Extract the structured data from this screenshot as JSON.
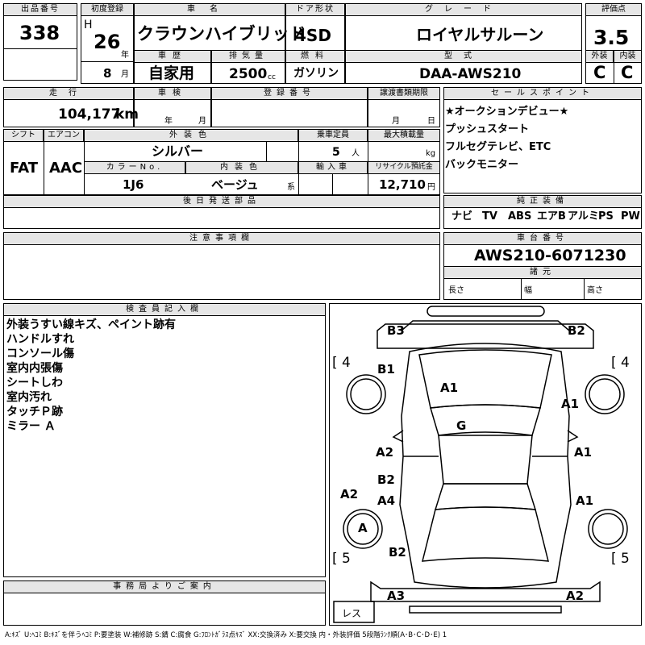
{
  "header": {
    "lot_label": "出品番号",
    "lot_number": "338",
    "first_reg_label": "初度登録",
    "era": "H",
    "year": "26",
    "year_unit": "年",
    "month": "8",
    "month_unit": "月",
    "car_name_label": "車名",
    "car_name": "クラウンハイブリッド",
    "history_label": "車歴",
    "history": "自家用",
    "displacement_label": "排気量",
    "displacement": "2500",
    "displacement_unit": "cc",
    "door_label": "ドア形状",
    "door": "4SD",
    "fuel_label": "燃料",
    "fuel": "ガソリン",
    "grade_label": "グレード",
    "grade": "ロイヤルサルーン",
    "model_label": "型式",
    "model": "DAA-AWS210",
    "score_label": "評価点",
    "score": "3.5",
    "exterior_label": "外装",
    "exterior": "C",
    "interior_label": "内装",
    "interior": "C"
  },
  "row2": {
    "mileage_label": "走行",
    "mileage": "104,177",
    "mileage_unit": "km",
    "inspection_label": "車検",
    "year_unit": "年",
    "month_unit": "月",
    "reg_label": "登録番号",
    "transfer_label": "譲渡書類期限",
    "day_unit": "日"
  },
  "spec": {
    "shift_label": "シフト",
    "shift": "FAT",
    "ac_label": "エアコン",
    "ac": "AAC",
    "ext_color_label": "外装色",
    "ext_color": "シルバー",
    "capacity_label": "乗車定員",
    "capacity": "5",
    "capacity_unit": "人",
    "load_label": "最大積載量",
    "load_unit": "kg",
    "color_no_label": "カラーNo.",
    "color_no": "1J6",
    "int_color_label": "内装色",
    "int_color": "ベージュ",
    "int_color_unit": "系",
    "import_label": "輸入車",
    "recycle_label": "リサイクル預託金",
    "recycle": "12,710",
    "recycle_unit": "円",
    "later_parts_label": "後日発送部品"
  },
  "sales": {
    "label": "セールスポイント",
    "items": [
      "★オークションデビュー★",
      "プッシュスタート",
      "フルセグテレビ、ETC",
      "バックモニター"
    ]
  },
  "equipment": {
    "label": "純正装備",
    "items": [
      "ナビ",
      "TV",
      "ABS",
      "エアB",
      "アルミ",
      "PS",
      "PW"
    ]
  },
  "notes_label": "注意事項欄",
  "chassis": {
    "label": "車台番号",
    "number": "AWS210-6071230"
  },
  "dimensions": {
    "label": "諸元",
    "length": "長さ",
    "width": "幅",
    "height": "高さ"
  },
  "inspector": {
    "label": "検査員記入欄",
    "items": [
      "外装うすい線キズ、ペイント跡有",
      "ハンドルすれ",
      "コンソール傷",
      "室内内張傷",
      "シートしわ",
      "室内汚れ",
      "タッチＰ跡",
      "ミラー Ａ"
    ]
  },
  "office_label": "事務局よりご案内",
  "diagram": {
    "codes": {
      "b3": "B3",
      "b2_top": "B2",
      "b1": "B1",
      "a1_hood": "A1",
      "a1_front_right": "A1",
      "g": "G",
      "a2_left": "A2",
      "a1_door_right": "A1",
      "b2_left": "B2",
      "a4": "A4",
      "a1_rear_right": "A1",
      "a2_quarter": "A2",
      "a_wheel": "A",
      "b2_trunk": "B2",
      "a3": "A3",
      "a2_bumper": "A2"
    },
    "tire_front_left": "4",
    "tire_front_right": "4",
    "tire_rear_left": "5",
    "tire_rear_right": "5",
    "spare": "レス"
  },
  "legend": "A:ｷｽﾞ U:ﾍｺﾐ B:ｷｽﾞを伴うﾍｺﾐ P:要塗装 W:補修跡 S:錆 C:腐食 G:ﾌﾛﾝﾄｶﾞﾗｽ点ｷｽﾞ XX:交換済み X:要交換 内・外装評価 5段階ﾗﾝｸ順(A･B･C･D･E) 1"
}
